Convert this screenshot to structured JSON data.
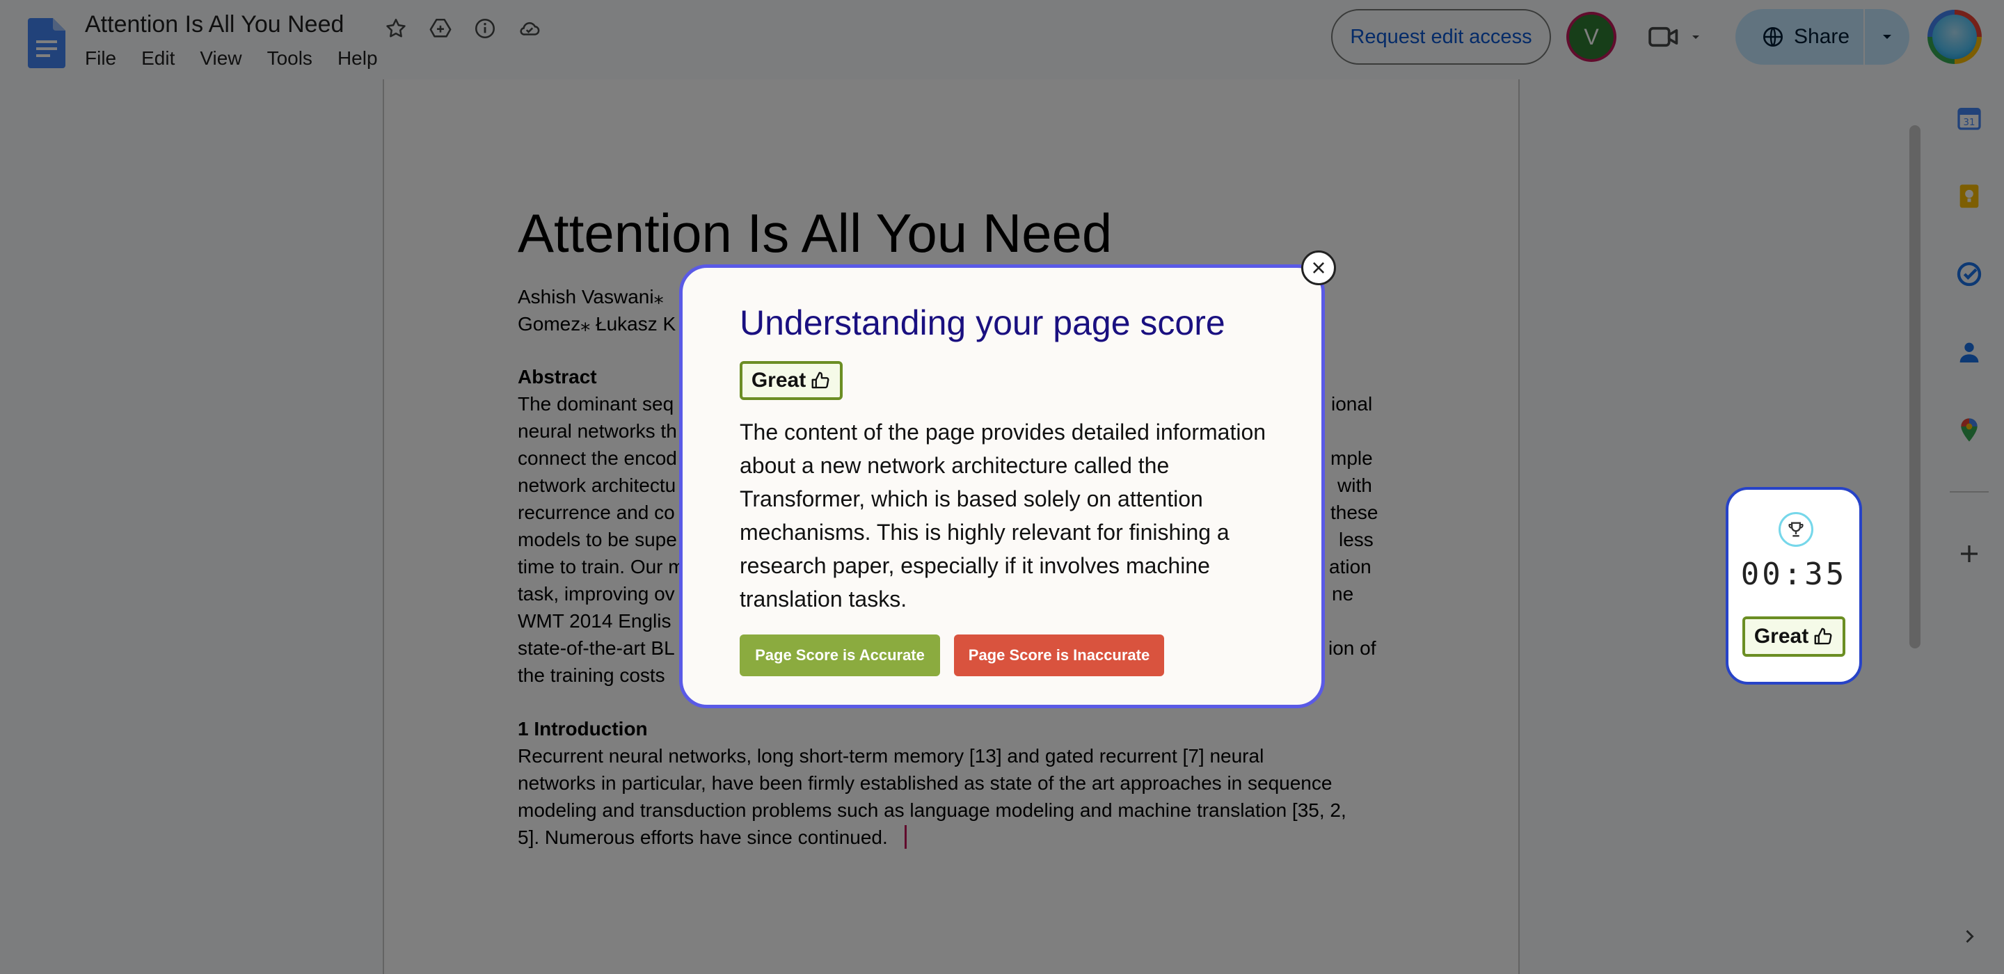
{
  "app": {
    "title": "Attention Is All You Need",
    "menu": [
      "File",
      "Edit",
      "View",
      "Tools",
      "Help"
    ],
    "request_edit_label": "Request edit access",
    "avatar_initial": "V",
    "share_label": "Share"
  },
  "document": {
    "heading": "Attention Is All You Need",
    "authors": [
      "Ashish Vaswani⁎",
      "Gomez⁎ Łukasz K"
    ],
    "abstract_heading": "Abstract",
    "abstract_left": [
      "The dominant seq",
      "neural networks th",
      "connect the encod",
      "network architectu",
      "recurrence and co",
      "models to be supe",
      "time to train. Our m",
      "task, improving ov",
      "WMT 2014 Englis",
      "state-of-the-art BL",
      "the training costs"
    ],
    "abstract_right": [
      "ional",
      "",
      "mple",
      "with",
      "these",
      "less",
      "ation",
      "ne",
      "",
      "ion of",
      ""
    ],
    "intro_heading": "1 Introduction",
    "intro_lines": [
      "Recurrent neural networks, long short-term memory [13] and gated recurrent [7] neural",
      "networks in particular, have been firmly established as state of the art approaches in sequence",
      "modeling and transduction problems such as language modeling and machine translation [35, 2,",
      "5]. Numerous efforts have since continued."
    ]
  },
  "widget": {
    "timer": "00:35",
    "badge_label": "Great"
  },
  "modal": {
    "title": "Understanding your page score",
    "badge_label": "Great",
    "description": "The content of the page provides detailed information about a new network architecture called the Transformer, which is based solely on attention mechanisms. This is highly relevant for finishing a research paper, especially if it involves machine translation tasks.",
    "accurate_label": "Page Score is Accurate",
    "inaccurate_label": "Page Score is Inaccurate",
    "close_symbol": "×"
  },
  "colors": {
    "brand_blue": "#0b57d0",
    "share_bg": "#c2e7ff",
    "modal_border": "#5a5ae6",
    "modal_title": "#1a1080",
    "accurate": "#8bab3f",
    "inaccurate": "#d9533e",
    "great_border": "#6b8e23",
    "widget_border": "#2743c7"
  }
}
